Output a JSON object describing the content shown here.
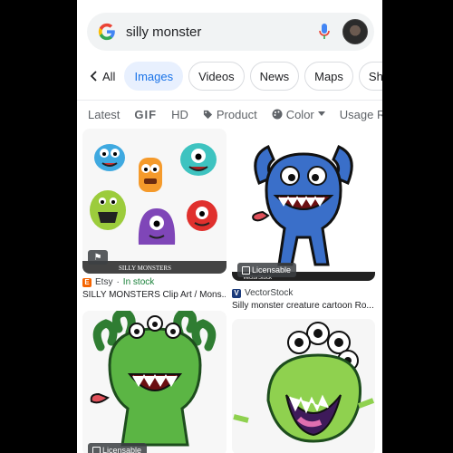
{
  "search": {
    "query": "silly monster"
  },
  "tabs": [
    {
      "label": "All"
    },
    {
      "label": "Images"
    },
    {
      "label": "Videos"
    },
    {
      "label": "News"
    },
    {
      "label": "Maps"
    },
    {
      "label": "Shoppin"
    }
  ],
  "filters": [
    {
      "label": "Latest"
    },
    {
      "label": "GIF"
    },
    {
      "label": "HD"
    },
    {
      "label": "Product"
    },
    {
      "label": "Color"
    },
    {
      "label": "Usage Rig"
    }
  ],
  "results": [
    {
      "source": "Etsy",
      "source_extra": "In stock",
      "separator": "·",
      "title": "SILLY MONSTERS Clip Art / Mons...",
      "image_text": "SILLY MONSTERS",
      "favicon_color": "#f56400"
    },
    {
      "source": "VectorStock",
      "title": "Silly monster creature cartoon Ro...",
      "badge": "Licensable",
      "watermark": "VectorStock",
      "favicon_color": "#1a3a7a"
    },
    {
      "badge": "Licensable"
    },
    {}
  ],
  "colors": {
    "accent": "#1a73e8",
    "active_tab_bg": "#e8f0fe",
    "in_stock": "#188038"
  },
  "icons": [
    "google-g-icon",
    "mic-icon",
    "avatar",
    "chevron-left-icon",
    "tag-icon",
    "palette-icon",
    "caret-down-icon",
    "licensable-icon"
  ]
}
